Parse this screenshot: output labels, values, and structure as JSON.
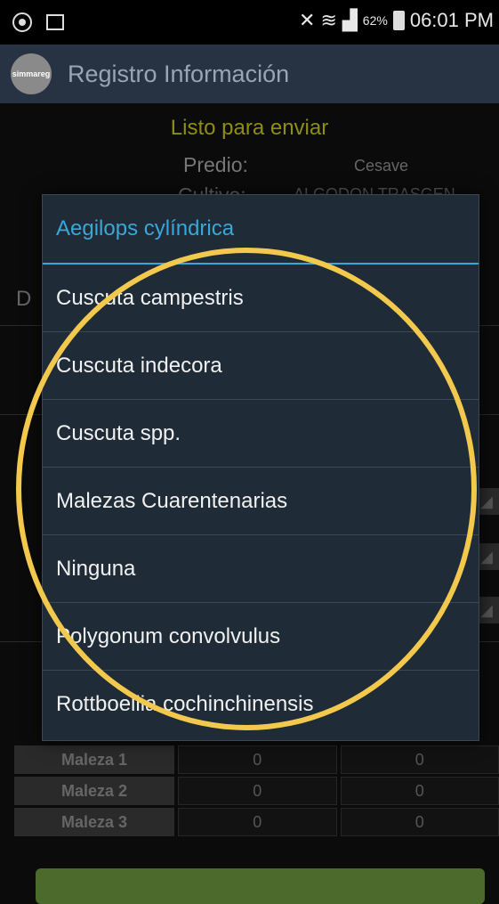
{
  "statusbar": {
    "battery": "62%",
    "time": "06:01 PM"
  },
  "app": {
    "logo_text": "simmareg",
    "title": "Registro Información"
  },
  "background": {
    "status": "Listo para enviar",
    "predio_label": "Predio:",
    "predio_value": "Cesave",
    "cultivo_label": "Cultivo:",
    "cultivo_value": "ALGODON TRASGEN",
    "d_label": "D",
    "weeds": [
      {
        "name": "Maleza 1",
        "v1": "0",
        "v2": "0"
      },
      {
        "name": "Maleza 2",
        "v1": "0",
        "v2": "0"
      },
      {
        "name": "Maleza 3",
        "v1": "0",
        "v2": "0"
      }
    ]
  },
  "dialog": {
    "title": "Aegilops cylíndrica",
    "options": [
      "Cuscuta campestris",
      "Cuscuta indecora",
      "Cuscuta spp.",
      "Malezas Cuarentenarias",
      "Ninguna",
      "Polygonum convolvulus",
      "Rottboellia cochinchinensis"
    ]
  },
  "colors": {
    "accent": "#3aa7d8",
    "highlight": "#f2c94c",
    "appbar": "#273342",
    "dialog_bg": "#1f2b36"
  }
}
